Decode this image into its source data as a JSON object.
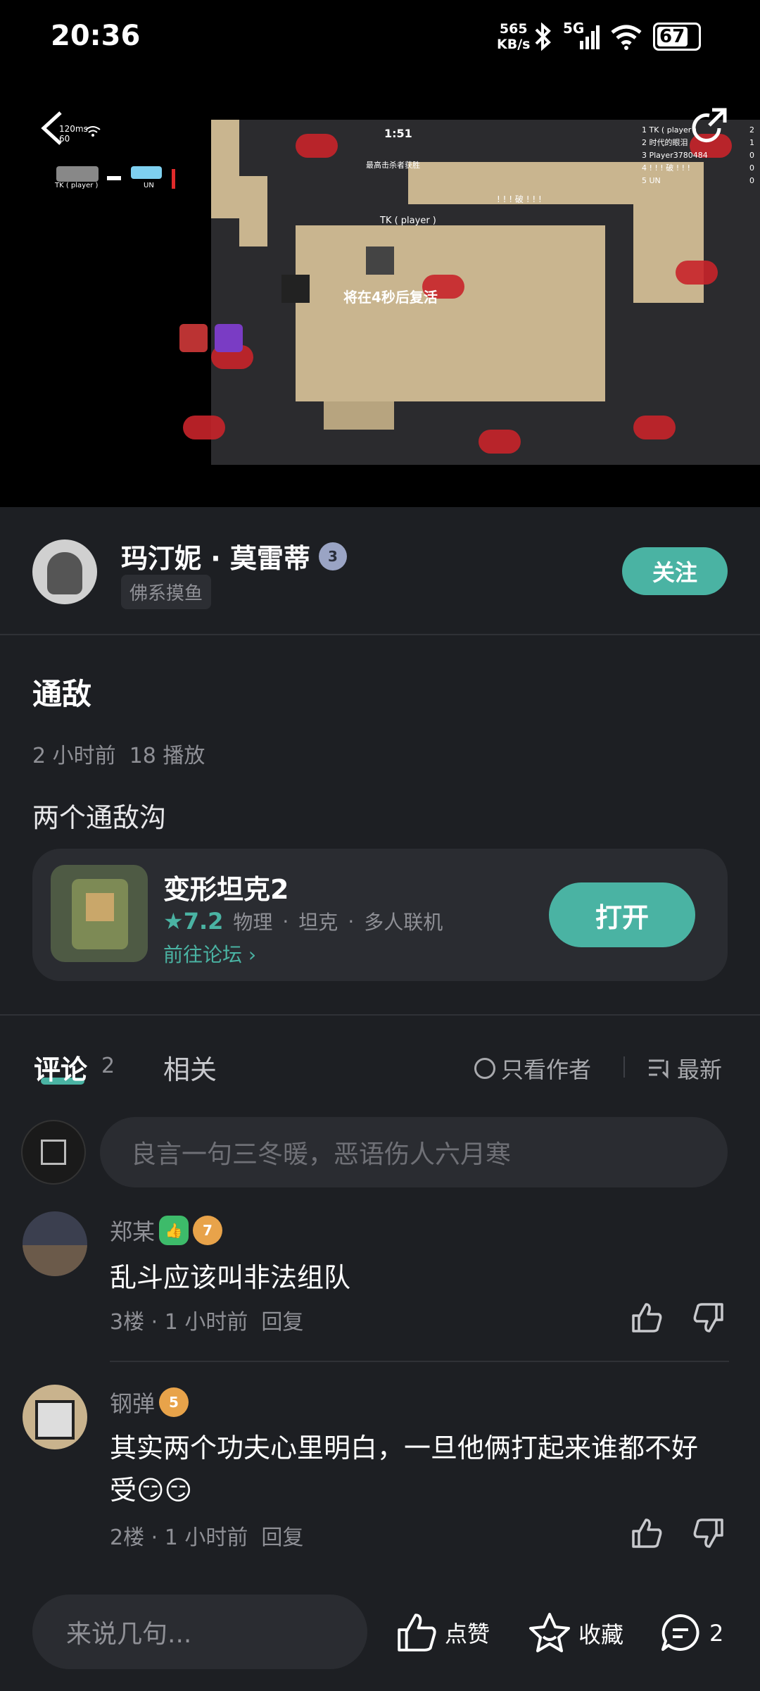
{
  "status": {
    "time": "20:36",
    "net_speed": "565",
    "net_unit": "KB/s",
    "signal": "5G",
    "battery": "67"
  },
  "video": {
    "ping": "120ms",
    "fps": "60",
    "player1": "TK ( player )",
    "player2": "UN",
    "timer": "1:51",
    "objective": "最高击杀者获胜",
    "respawn": "将在4秒后复活",
    "player_tag": "TK ( player )",
    "enemy_tag": "! ! ! 破 ! ! !",
    "leaderboard": [
      "1 TK ( player )",
      "2 时代的眼泪",
      "3 Player3780484",
      "4 ! ! ! 破 ! ! !",
      "5 UN"
    ],
    "scores": [
      "2",
      "1",
      "0",
      "0",
      "0"
    ]
  },
  "author": {
    "name": "玛汀妮 · 莫雷蒂",
    "level": "3",
    "tag": "佛系摸鱼",
    "follow_label": "关注"
  },
  "post": {
    "title": "通敌",
    "time": "2 小时前",
    "plays": "18 播放",
    "body": "两个通敌沟"
  },
  "game": {
    "name": "变形坦克2",
    "rating": "7.2",
    "tags": [
      "物理",
      "坦克",
      "多人联机"
    ],
    "forum_link": "前往论坛",
    "open_label": "打开"
  },
  "tabs": {
    "comment": "评论",
    "comment_count": "2",
    "related": "相关",
    "author_only": "只看作者",
    "sort": "最新"
  },
  "comment_placeholder": "良言一句三冬暖，恶语伤人六月寒",
  "comments": [
    {
      "user": "郑某",
      "level": "7",
      "text": "乱斗应该叫非法组队",
      "floor": "3楼",
      "time": "1 小时前",
      "reply": "回复"
    },
    {
      "user": "钢弹",
      "level": "5",
      "text": "其实两个功夫心里明白，一旦他俩打起来谁都不好受😏😏",
      "floor": "2楼",
      "time": "1 小时前",
      "reply": "回复"
    }
  ],
  "bottom_bar": {
    "placeholder": "来说几句...",
    "like": "点赞",
    "favorite": "收藏",
    "comment_count": "2"
  },
  "colors": {
    "accent": "#4ab3a3",
    "background": "#1d1f23"
  }
}
